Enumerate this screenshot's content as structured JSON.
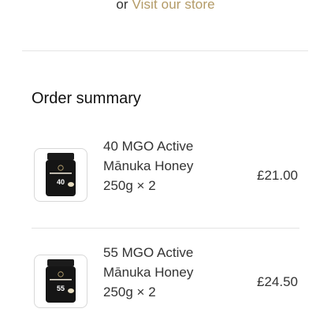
{
  "store_link": {
    "prefix": "or",
    "link_text": "Visit our store"
  },
  "summary": {
    "title": "Order summary"
  },
  "items": [
    {
      "name_lines": [
        "40 MGO Active",
        "Mānuka Honey",
        "250g × 2"
      ],
      "price": "£21.00",
      "jar_brand": "ManukaPharm",
      "jar_grade": "40"
    },
    {
      "name_lines": [
        "55 MGO Active",
        "Mānuka Honey",
        "250g × 2"
      ],
      "price": "£24.50",
      "jar_brand": "ManukaPharm",
      "jar_grade": "55"
    }
  ],
  "colors": {
    "accent": "#b39a66",
    "divider": "#e4e4e4",
    "text": "#333333"
  }
}
